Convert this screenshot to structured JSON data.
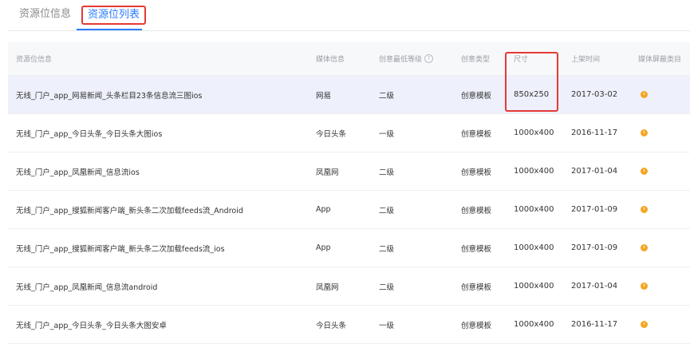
{
  "tabs": [
    {
      "label": "资源位信息"
    },
    {
      "label": "资源位列表"
    }
  ],
  "table": {
    "headers": [
      "资源位信息",
      "媒体信息",
      "创意最低等级",
      "创意类型",
      "尺寸",
      "上架时间",
      "媒体屏蔽类目"
    ],
    "help_glyph": "?",
    "rows": [
      {
        "name": "无线_门户_app_网易新闻_头条栏目23条信息流三图ios",
        "media": "网易",
        "level": "二级",
        "type": "创意模板",
        "size": "850x250",
        "date": "2017-03-02"
      },
      {
        "name": "无线_门户_app_今日头条_今日头条大图ios",
        "media": "今日头条",
        "level": "一级",
        "type": "创意模板",
        "size": "1000x400",
        "date": "2016-11-17"
      },
      {
        "name": "无线_门户_app_凤凰新闻_信息流ios",
        "media": "凤凰网",
        "level": "二级",
        "type": "创意模板",
        "size": "1000x400",
        "date": "2017-01-04"
      },
      {
        "name": "无线_门户_app_搜狐新闻客户端_新头条二次加载feeds流_Android",
        "media": "App",
        "level": "二级",
        "type": "创意模板",
        "size": "1000x400",
        "date": "2017-01-09"
      },
      {
        "name": "无线_门户_app_搜狐新闻客户端_新头条二次加载feeds流_ios",
        "media": "App",
        "level": "二级",
        "type": "创意模板",
        "size": "1000x400",
        "date": "2017-01-09"
      },
      {
        "name": "无线_门户_app_凤凰新闻_信息流android",
        "media": "凤凰网",
        "level": "二级",
        "type": "创意模板",
        "size": "1000x400",
        "date": "2017-01-04"
      },
      {
        "name": "无线_门户_app_今日头条_今日头条大图安卓",
        "media": "今日头条",
        "level": "一级",
        "type": "创意模板",
        "size": "1000x400",
        "date": "2016-11-17"
      }
    ]
  },
  "colors": {
    "accent": "#2b7cff",
    "highlight": "#e53935",
    "warning_dot": "#f5a623",
    "selected_row": "#eef0fb"
  },
  "icons": {
    "block_category": "warning-dot-icon",
    "help": "question-circle-icon"
  }
}
